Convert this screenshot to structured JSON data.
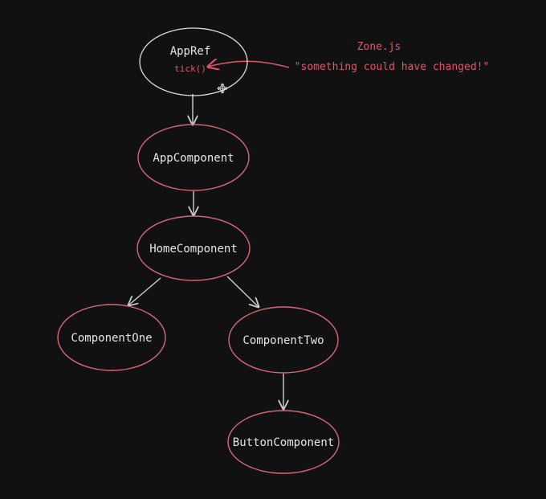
{
  "colors": {
    "background": "#111111",
    "node_stroke_red": "#d9677a",
    "node_stroke_white": "#dedede",
    "edge": "#cfcfcf",
    "annotation": "#e0556e",
    "label": "#e6e6e6"
  },
  "nodes": {
    "appref": {
      "label": "AppRef",
      "sub": "tick()"
    },
    "appcomponent": {
      "label": "AppComponent"
    },
    "homecomponent": {
      "label": "HomeComponent"
    },
    "componentone": {
      "label": "ComponentOne"
    },
    "componenttwo": {
      "label": "ComponentTwo"
    },
    "buttoncomponent": {
      "label": "ButtonComponent"
    }
  },
  "annotation": {
    "title": "Zone.js",
    "quote": "\"something could have changed!\""
  },
  "edges": [
    {
      "from": "appref",
      "to": "appcomponent"
    },
    {
      "from": "appcomponent",
      "to": "homecomponent"
    },
    {
      "from": "homecomponent",
      "to": "componentone"
    },
    {
      "from": "homecomponent",
      "to": "componenttwo"
    },
    {
      "from": "componenttwo",
      "to": "buttoncomponent"
    },
    {
      "from": "annotation",
      "to": "appref"
    }
  ]
}
